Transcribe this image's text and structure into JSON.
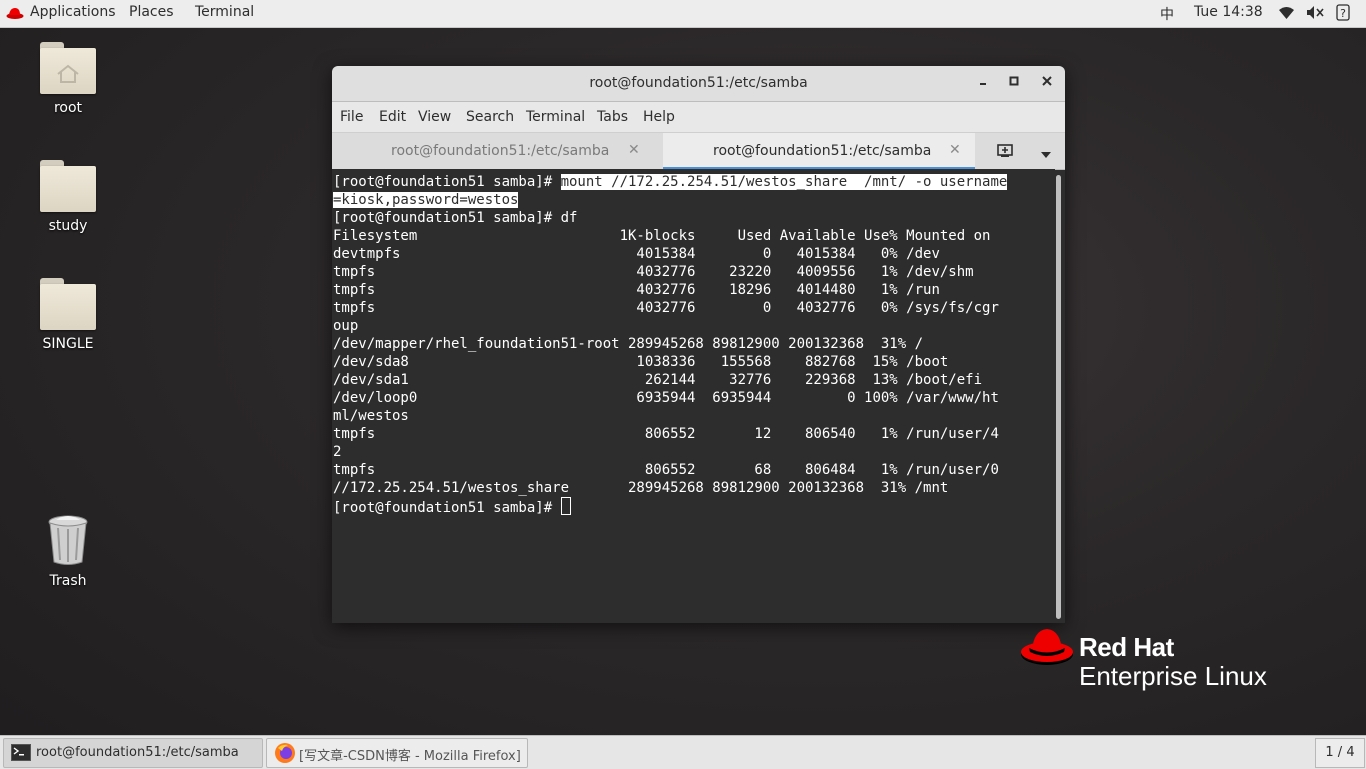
{
  "topbar": {
    "applications": "Applications",
    "places": "Places",
    "terminal": "Terminal",
    "input_method": "中",
    "clock": "Tue 14:38",
    "icons": [
      "wifi-icon",
      "volume-muted-icon",
      "power-menu-icon"
    ]
  },
  "desktop": {
    "icons": [
      {
        "label": "root",
        "icon": "home-folder-icon"
      },
      {
        "label": "study",
        "icon": "folder-icon"
      },
      {
        "label": "SINGLE",
        "icon": "folder-icon"
      },
      {
        "label": "Trash",
        "icon": "trash-icon"
      }
    ]
  },
  "terminal": {
    "title": "root@foundation51:/etc/samba",
    "menu": [
      "File",
      "Edit",
      "View",
      "Search",
      "Terminal",
      "Tabs",
      "Help"
    ],
    "tabs": [
      {
        "label": "root@foundation51:/etc/samba",
        "active": false
      },
      {
        "label": "root@foundation51:/etc/samba",
        "active": true
      }
    ],
    "prompt": "[root@foundation51 samba]# ",
    "selected_command_1": "mount //172.25.254.51/westos_share  /mnt/ -o username",
    "selected_command_2": "=kiosk,password=westos",
    "output_lines": [
      "[root@foundation51 samba]# df",
      "Filesystem                        1K-blocks     Used Available Use% Mounted on",
      "devtmpfs                            4015384        0   4015384   0% /dev",
      "tmpfs                               4032776    23220   4009556   1% /dev/shm",
      "tmpfs                               4032776    18296   4014480   1% /run",
      "tmpfs                               4032776        0   4032776   0% /sys/fs/cgr",
      "oup",
      "/dev/mapper/rhel_foundation51-root 289945268 89812900 200132368  31% /",
      "/dev/sda8                           1038336   155568    882768  15% /boot",
      "/dev/sda1                            262144    32776    229368  13% /boot/efi",
      "/dev/loop0                          6935944  6935944         0 100% /var/www/ht",
      "ml/westos",
      "tmpfs                                806552       12    806540   1% /run/user/4",
      "2",
      "tmpfs                                806552       68    806484   1% /run/user/0",
      "//172.25.254.51/westos_share       289945268 89812900 200132368  31% /mnt"
    ]
  },
  "branding": {
    "line1": "Red Hat",
    "line2": "Enterprise Linux"
  },
  "taskbar": {
    "items": [
      {
        "label": "root@foundation51:/etc/samba",
        "icon": "terminal-icon"
      },
      {
        "label": "[写文章-CSDN博客 - Mozilla Firefox]",
        "icon": "firefox-icon"
      }
    ],
    "workspace": "1 / 4"
  },
  "colors": {
    "terminal_bg": "#2d2d2d",
    "redhat_red": "#ee0000",
    "accent_blue": "#4a90d9"
  }
}
